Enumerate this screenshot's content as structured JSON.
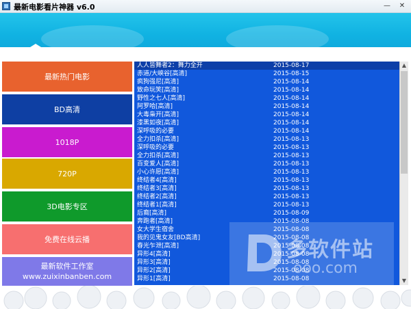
{
  "window": {
    "title": "最新电影看片神器 v6.0",
    "min_glyph": "—",
    "close_glyph": "✕"
  },
  "menu": [
    {
      "label": "最新热门电影",
      "sub": "",
      "color": "#e8622e"
    },
    {
      "label": "BD高清",
      "sub": "",
      "color": "#0e3fa3"
    },
    {
      "label": "1018P",
      "sub": "",
      "color": "#c91bcf"
    },
    {
      "label": "720P",
      "sub": "",
      "color": "#d9a800"
    },
    {
      "label": "3D电影专区",
      "sub": "",
      "color": "#0f9a2b"
    },
    {
      "label": "免费在线云播",
      "sub": "",
      "color": "#f76f6f"
    },
    {
      "label": "最新软件工作室",
      "sub": "www.zuixinbanben.com",
      "color": "#7f79e8"
    }
  ],
  "movies": [
    {
      "name": "人人皆舞者2：舞力全开",
      "date": "2015-08-17"
    },
    {
      "name": "赤道/大峡谷[高清]",
      "date": "2015-08-15"
    },
    {
      "name": "疯狗强尼[高清]",
      "date": "2015-08-14"
    },
    {
      "name": "致命玩笑[高清]",
      "date": "2015-08-14"
    },
    {
      "name": "野性之七人[高清]",
      "date": "2015-08-14"
    },
    {
      "name": "阿罗哈[高清]",
      "date": "2015-08-14"
    },
    {
      "name": "大毒枭开[高清]",
      "date": "2015-08-14"
    },
    {
      "name": "漆黑如夜[高清]",
      "date": "2015-08-14"
    },
    {
      "name": "深呼吸的必要",
      "date": "2015-08-14"
    },
    {
      "name": "全力扣杀[高清]",
      "date": "2015-08-13"
    },
    {
      "name": "深呼吸的必要",
      "date": "2015-08-13"
    },
    {
      "name": "全力扣杀[高清]",
      "date": "2015-08-13"
    },
    {
      "name": "百变爱人[高清]",
      "date": "2015-08-13"
    },
    {
      "name": "小心许愿[高清]",
      "date": "2015-08-13"
    },
    {
      "name": "终结者4[高清]",
      "date": "2015-08-13"
    },
    {
      "name": "终结者3[高清]",
      "date": "2015-08-13"
    },
    {
      "name": "终结者2[高清]",
      "date": "2015-08-13"
    },
    {
      "name": "终结者1[高清]",
      "date": "2015-08-13"
    },
    {
      "name": "后裔[高清]",
      "date": "2015-08-09"
    },
    {
      "name": "奔跑者[高清]",
      "date": "2015-08-08"
    },
    {
      "name": "女大学生宿舍",
      "date": "2015-08-08"
    },
    {
      "name": "我的见鬼女友[BD高清]",
      "date": "2015-08-08"
    },
    {
      "name": "春光乍泄[高清]",
      "date": "2015-08-08"
    },
    {
      "name": "异形4[高清]",
      "date": "2015-08-08"
    },
    {
      "name": "异形3[高清]",
      "date": "2015-08-08"
    },
    {
      "name": "异形2[高清]",
      "date": "2015-08-08"
    },
    {
      "name": "异形1[高清]",
      "date": "2015-08-08"
    }
  ],
  "scroll": {
    "up_glyph": "▲",
    "down_glyph": "▼"
  },
  "watermark": {
    "text": "多软件站",
    "url": "ooo.com"
  },
  "colors": {
    "banner": "#1bbbe6",
    "list_background": "#1158dc"
  }
}
